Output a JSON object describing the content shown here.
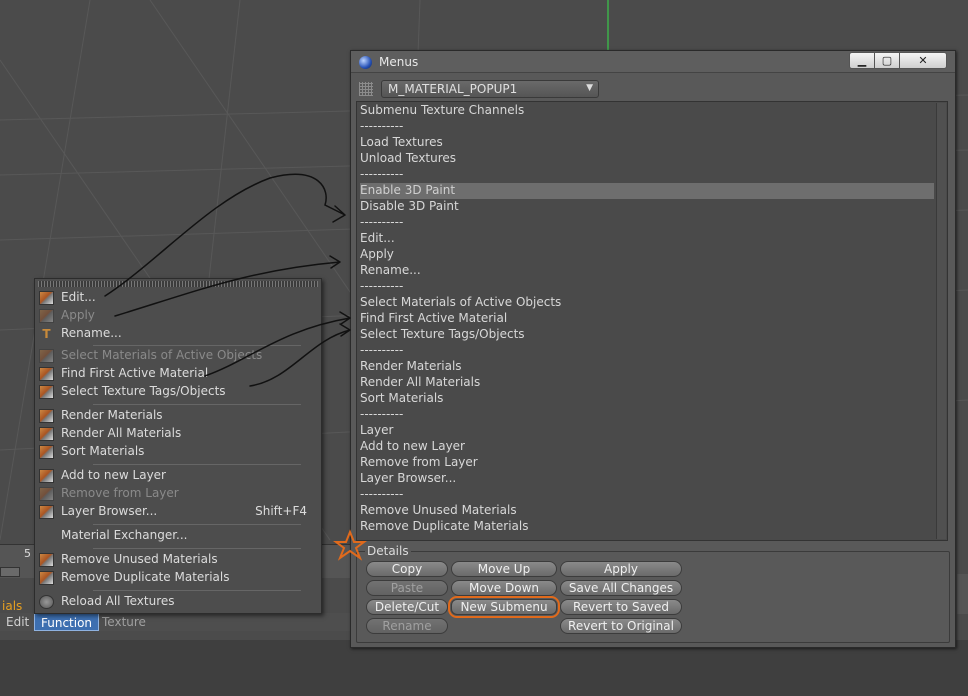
{
  "popup_menu": {
    "items": [
      {
        "label": "Edit...",
        "enabled": true,
        "icon": "material-edit-icon"
      },
      {
        "label": "Apply",
        "enabled": false,
        "icon": "material-apply-icon"
      },
      {
        "label": "Rename...",
        "enabled": true,
        "icon": "rename-icon"
      },
      {
        "label": "Select Materials of Active Objects",
        "enabled": false,
        "icon": "select-materials-icon"
      },
      {
        "label": "Find First Active Material",
        "enabled": true,
        "icon": "find-material-icon"
      },
      {
        "label": "Select Texture Tags/Objects",
        "enabled": true,
        "icon": "select-texture-tags-icon"
      },
      {
        "label": "Render Materials",
        "enabled": true,
        "icon": "render-materials-icon"
      },
      {
        "label": "Render All Materials",
        "enabled": true,
        "icon": "render-all-materials-icon"
      },
      {
        "label": "Sort Materials",
        "enabled": true,
        "icon": "sort-materials-icon"
      },
      {
        "label": "Add to new Layer",
        "enabled": true,
        "icon": "add-layer-icon"
      },
      {
        "label": "Remove from Layer",
        "enabled": false,
        "icon": "remove-layer-icon"
      },
      {
        "label": "Layer Browser...",
        "enabled": true,
        "icon": "layer-browser-icon",
        "shortcut": "Shift+F4"
      },
      {
        "label": "Material Exchanger...",
        "enabled": true,
        "icon": ""
      },
      {
        "label": "Remove Unused Materials",
        "enabled": true,
        "icon": "remove-unused-icon"
      },
      {
        "label": "Remove Duplicate Materials",
        "enabled": true,
        "icon": "remove-duplicate-icon"
      },
      {
        "label": "Reload All Textures",
        "enabled": true,
        "icon": "reload-textures-icon"
      }
    ]
  },
  "menu_bar": {
    "partial_label": "ials",
    "items": [
      "Edit",
      "Function",
      "Texture"
    ],
    "active": "Function"
  },
  "timeline": {
    "frame_label": "5"
  },
  "window": {
    "title": "Menus",
    "minimize": "▁",
    "maximize": "▢",
    "close": "✕",
    "menu_select_value": "M_MATERIAL_POPUP1",
    "entries": [
      "Submenu Texture Channels",
      "----------",
      "Load Textures",
      "Unload Textures",
      "----------",
      "Enable 3D Paint",
      "Disable 3D Paint",
      "----------",
      "Edit...",
      "Apply",
      "Rename...",
      "----------",
      "Select Materials of Active Objects",
      "Find First Active Material",
      "Select Texture Tags/Objects",
      "----------",
      "Render Materials",
      "Render All Materials",
      "Sort Materials",
      "----------",
      "Layer",
      "Add to new Layer",
      "Remove from Layer",
      "Layer Browser...",
      "----------",
      "Remove Unused Materials",
      "Remove Duplicate Materials"
    ],
    "selected_entry": "Enable 3D Paint",
    "details": {
      "label": "Details",
      "buttons": {
        "copy": "Copy",
        "paste": "Paste",
        "delete_cut": "Delete/Cut",
        "rename": "Rename",
        "move_up": "Move Up",
        "move_down": "Move Down",
        "new_submenu": "New Submenu",
        "apply": "Apply",
        "save_all": "Save All Changes",
        "revert_saved": "Revert to Saved",
        "revert_original": "Revert to Original"
      }
    }
  },
  "colors": {
    "background": "#4b4b4b",
    "window": "#595959",
    "active_menu": "#3d6fb0",
    "annotation_orange": "#e06a1c",
    "annotation_ink": "#111111"
  }
}
